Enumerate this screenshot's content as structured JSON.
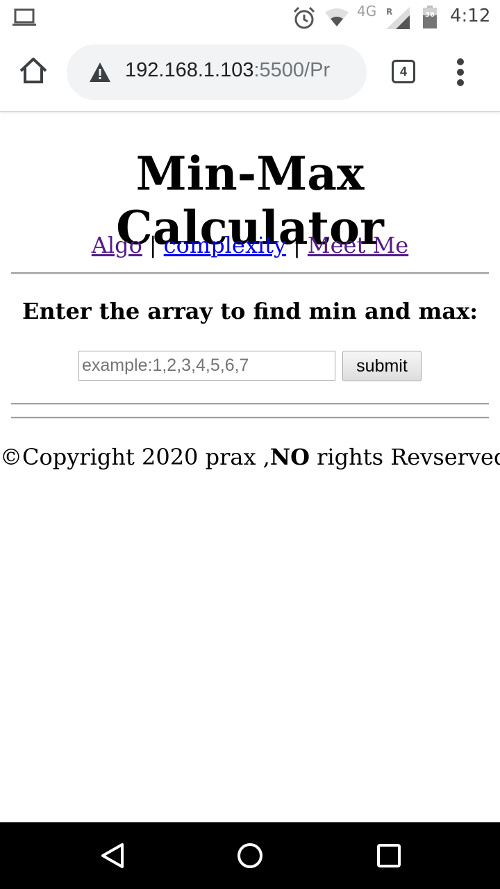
{
  "status_bar": {
    "network": "4G",
    "roaming": "R",
    "battery": "36",
    "time": "4:12"
  },
  "browser": {
    "url_host": "192.168.1.103",
    "url_path": ":5500/Pr",
    "tab_count": "4"
  },
  "page": {
    "title": "Min-Max Calculator",
    "nav": {
      "links": [
        "Algo",
        "complexity",
        "Meet Me"
      ],
      "separator": "|"
    },
    "prompt": "Enter the array to find min and max:",
    "input_placeholder": "example:1,2,3,4,5,6,7",
    "input_value": "",
    "submit_label": "submit",
    "footer": {
      "prefix": "©Copyright 2020 prax ,",
      "bold": "NO",
      "suffix": " rights Revserved."
    }
  }
}
